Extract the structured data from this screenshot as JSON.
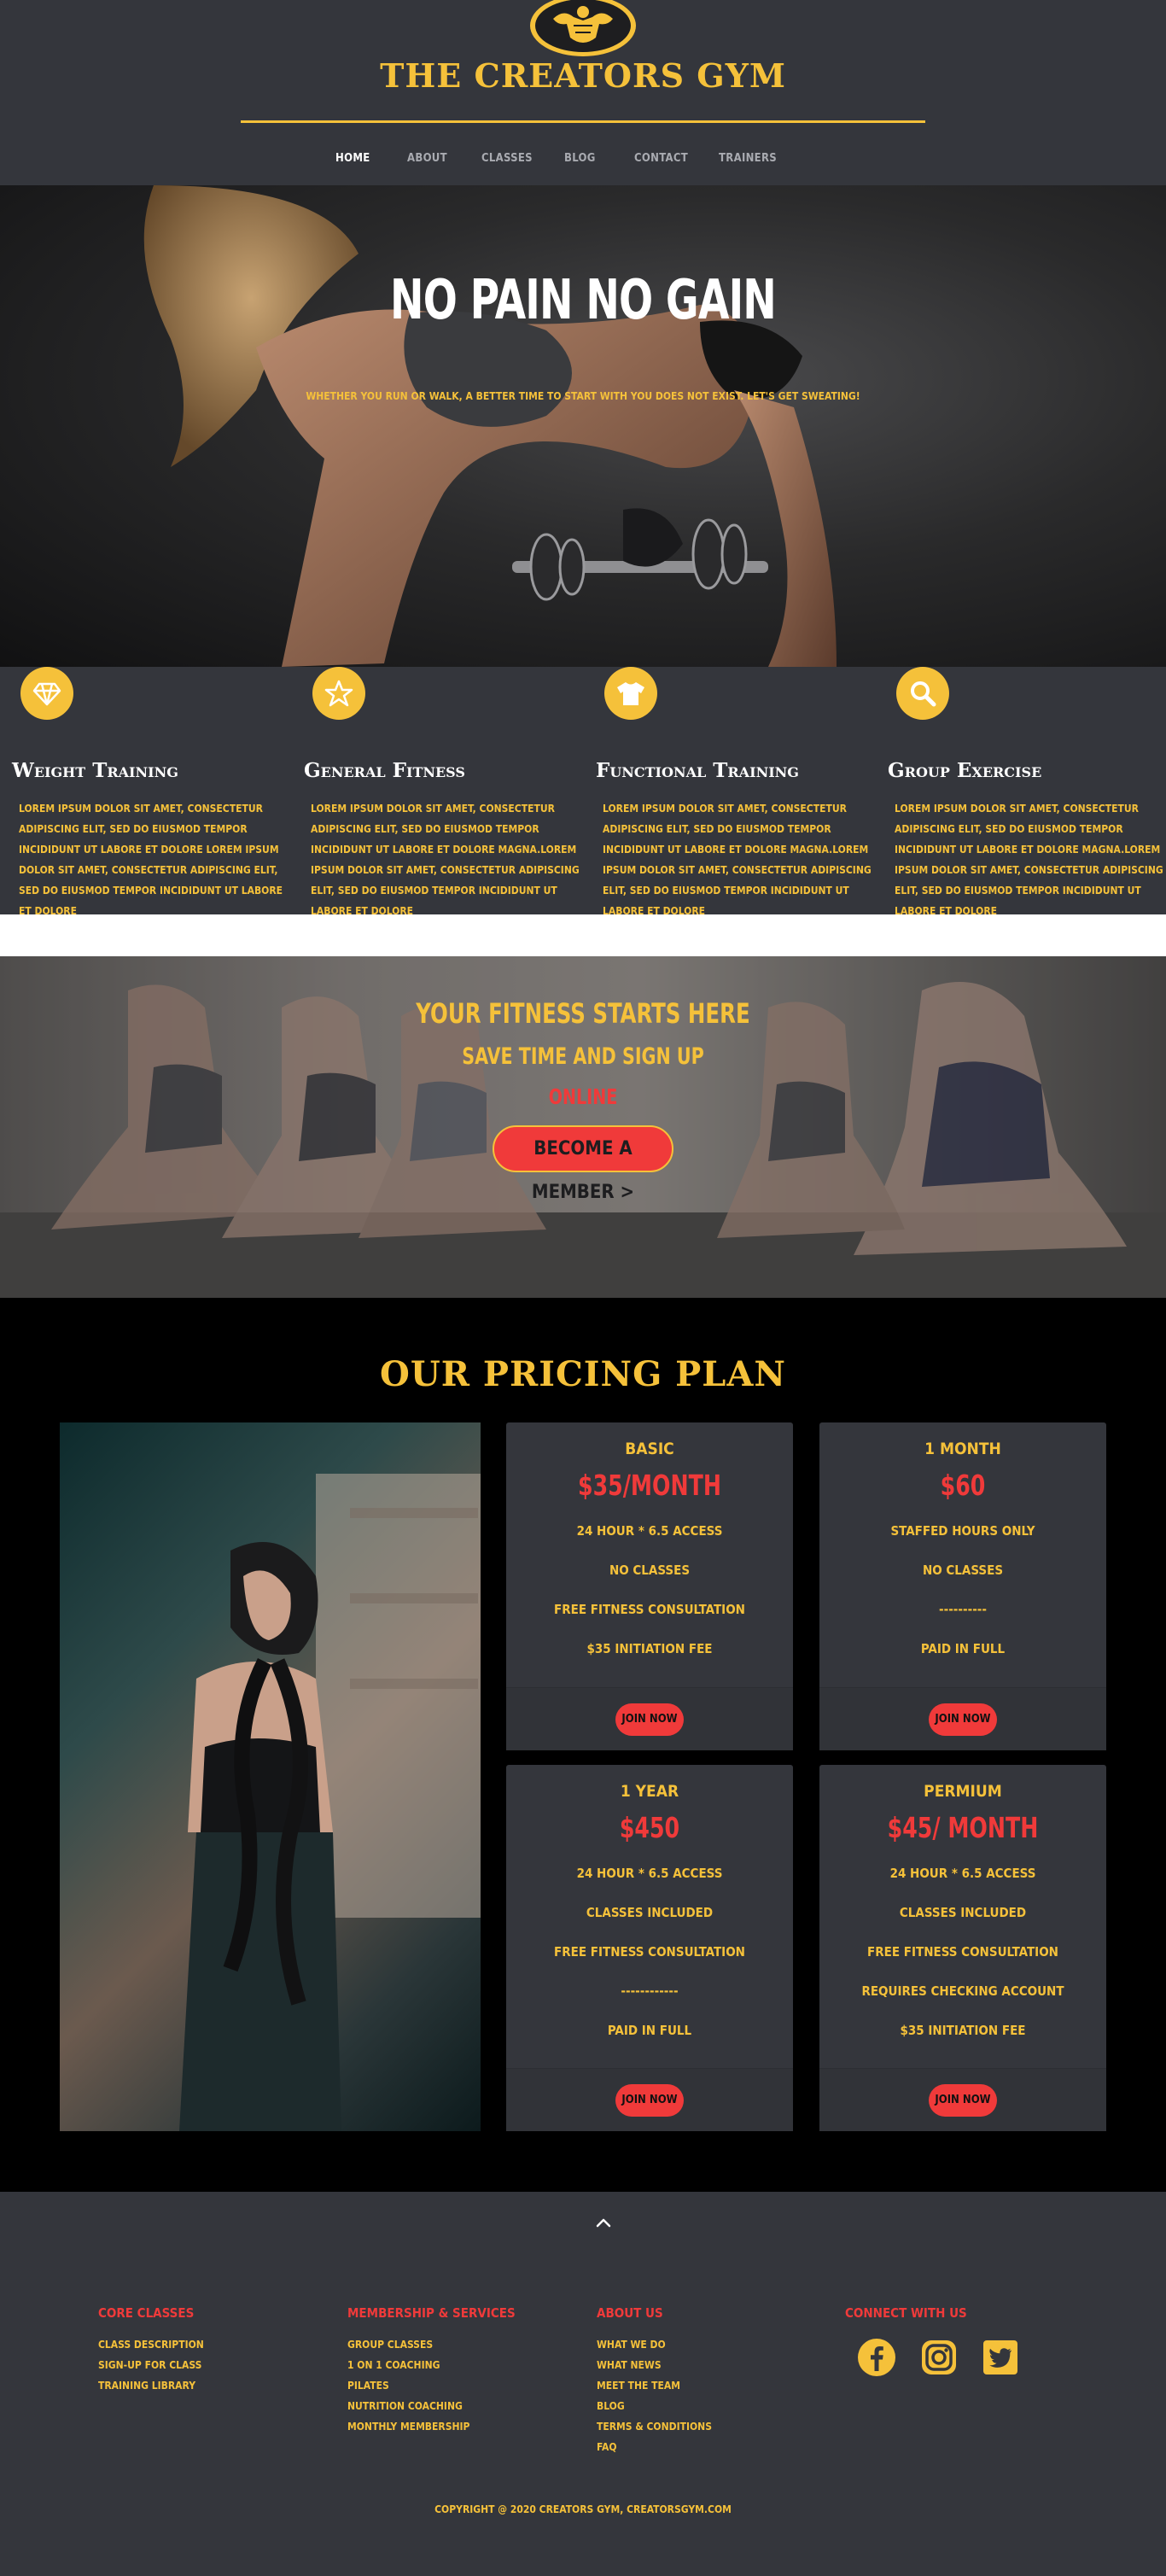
{
  "brand": {
    "site_title": "THE CREATORS GYM"
  },
  "nav": {
    "items": [
      "HOME",
      "ABOUT",
      "CLASSES",
      "BLOG",
      "CONTACT",
      "TRAINERS"
    ]
  },
  "hero": {
    "title": "NO PAIN NO GAIN",
    "subtitle": "WHETHER YOU RUN OR WALK, A BETTER TIME TO START WITH YOU DOES NOT EXIST. LET'S GET SWEATING!"
  },
  "features": [
    {
      "icon": "diamond-icon",
      "title": "Weight Training",
      "text": "LOREM IPSUM DOLOR SIT AMET, CONSECTETUR ADIPISCING ELIT, SED DO EIUSMOD TEMPOR INCIDIDUNT UT LABORE ET DOLORE LOREM IPSUM DOLOR SIT AMET, CONSECTETUR ADIPISCING ELIT, SED DO EIUSMOD TEMPOR INCIDIDUNT UT LABORE ET DOLORE"
    },
    {
      "icon": "star-icon",
      "title": "General Fitness",
      "text": "LOREM IPSUM DOLOR SIT AMET, CONSECTETUR ADIPISCING ELIT, SED DO EIUSMOD TEMPOR INCIDIDUNT UT LABORE ET DOLORE MAGNA.LOREM IPSUM DOLOR SIT AMET, CONSECTETUR ADIPISCING ELIT, SED DO EIUSMOD TEMPOR INCIDIDUNT UT LABORE ET DOLORE"
    },
    {
      "icon": "tshirt-icon",
      "title": "Functional Training",
      "text": "LOREM IPSUM DOLOR SIT AMET, CONSECTETUR ADIPISCING ELIT, SED DO EIUSMOD TEMPOR INCIDIDUNT UT LABORE ET DOLORE MAGNA.LOREM IPSUM DOLOR SIT AMET, CONSECTETUR ADIPISCING ELIT, SED DO EIUSMOD TEMPOR INCIDIDUNT UT LABORE ET DOLORE"
    },
    {
      "icon": "search-icon",
      "title": "Group Exercise",
      "text": "LOREM IPSUM DOLOR SIT AMET, CONSECTETUR ADIPISCING ELIT, SED DO EIUSMOD TEMPOR INCIDIDUNT UT LABORE ET DOLORE MAGNA.LOREM IPSUM DOLOR SIT AMET, CONSECTETUR ADIPISCING ELIT, SED DO EIUSMOD TEMPOR INCIDIDUNT UT LABORE ET DOLORE"
    }
  ],
  "cta": {
    "title": "YOUR FITNESS STARTS HERE",
    "subtitle": "SAVE TIME AND SIGN UP",
    "online": "ONLINE",
    "button": "BECOME A MEMBER >"
  },
  "pricing": {
    "title": "OUR PRICING PLAN",
    "plans": [
      {
        "name": "BASIC",
        "price": "$35/MONTH",
        "features": [
          "24 HOUR * 6.5 ACCESS",
          "NO CLASSES",
          "FREE FITNESS CONSULTATION",
          "$35 INITIATION FEE"
        ],
        "button": "JOIN NOW"
      },
      {
        "name": "1 MONTH",
        "price": "$60",
        "features": [
          "STAFFED HOURS ONLY",
          "NO CLASSES",
          "----------",
          "PAID IN FULL"
        ],
        "button": "JOIN NOW"
      },
      {
        "name": "1 YEAR",
        "price": "$450",
        "features": [
          "24 HOUR * 6.5 ACCESS",
          "CLASSES INCLUDED",
          "FREE FITNESS CONSULTATION",
          "------------",
          "PAID IN FULL"
        ],
        "button": "JOIN NOW"
      },
      {
        "name": "PERMIUM",
        "price": "$45/ MONTH",
        "features": [
          "24 HOUR * 6.5 ACCESS",
          "CLASSES INCLUDED",
          "FREE FITNESS CONSULTATION",
          "REQUIRES CHECKING ACCOUNT",
          "$35 INITIATION FEE"
        ],
        "button": "JOIN NOW"
      }
    ]
  },
  "footer": {
    "columns": [
      {
        "heading": "CORE CLASSES",
        "links": [
          "CLASS DESCRIPTION",
          "SIGN-UP FOR CLASS",
          "TRAINING LIBRARY"
        ]
      },
      {
        "heading": "MEMBERSHIP & SERVICES",
        "links": [
          "GROUP CLASSES",
          "1 ON 1 COACHING",
          "PILATES",
          "NUTRITION COACHING",
          "MONTHLY MEMBERSHIP"
        ]
      },
      {
        "heading": "ABOUT US",
        "links": [
          "WHAT WE DO",
          "WHAT NEWS",
          "MEET THE TEAM",
          "BLOG",
          "TERMS & CONDITIONS",
          "FAQ"
        ]
      },
      {
        "heading": "CONNECT WITH US",
        "links": []
      }
    ],
    "social": [
      "facebook-icon",
      "instagram-icon",
      "twitter-icon"
    ],
    "copyright": "COPYRIGHT @ 2020 CREATORS GYM, CREATORSGYM.COM"
  },
  "colors": {
    "accent": "#f5c13a",
    "danger": "#f03a3a",
    "panel": "#34363c",
    "black": "#000000"
  }
}
